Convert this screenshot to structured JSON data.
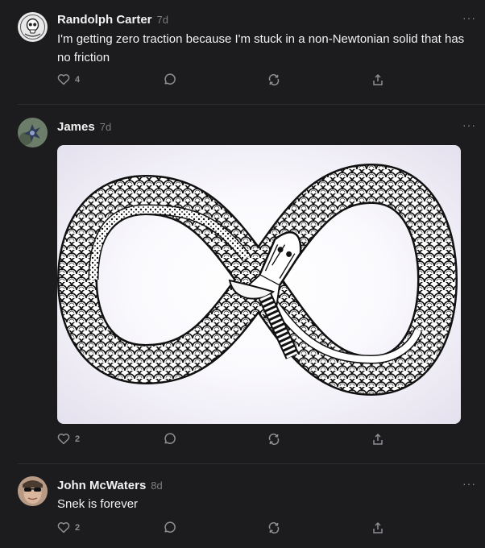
{
  "posts": [
    {
      "author": "Randolph Carter",
      "time": "7d",
      "text": "I'm getting zero traction because I'm stuck in a non-Newtonian solid that has no friction",
      "likes": "4",
      "more": "···"
    },
    {
      "author": "James",
      "time": "7d",
      "likes": "2",
      "more": "···",
      "image_alt": "Ouroboros snake in infinity shape illustration"
    },
    {
      "author": "John McWaters",
      "time": "8d",
      "text": "Snek is forever",
      "likes": "2",
      "more": "···"
    }
  ],
  "icons": {
    "like": "heart-icon",
    "reply": "reply-icon",
    "repost": "repost-icon",
    "share": "share-icon"
  },
  "colors": {
    "background": "#1c1c1e",
    "text": "#f2f2f2",
    "muted": "#8e8e93",
    "divider": "#2e2e31"
  }
}
